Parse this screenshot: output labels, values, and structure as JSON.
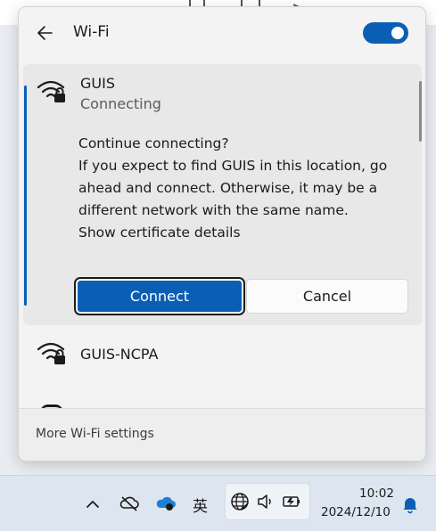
{
  "header": {
    "title": "Wi-Fi",
    "wifi_enabled": true
  },
  "expanded_network": {
    "name": "GUIS",
    "status": "Connecting",
    "prompt_lines": [
      "Continue connecting?",
      "If you expect to find GUIS in this location, go",
      "ahead and connect. Otherwise, it may be a",
      "different network with the same name.",
      "Show certificate details"
    ],
    "connect_label": "Connect",
    "cancel_label": "Cancel"
  },
  "networks": [
    {
      "name": "GUIS-NCPA"
    }
  ],
  "footer": {
    "settings_link": "More Wi-Fi settings"
  },
  "taskbar": {
    "ime_label": "英",
    "time": "10:02",
    "date": "2024/12/10"
  },
  "colors": {
    "accent": "#0a5fb4",
    "panel_bg": "#f3f3f3",
    "card_bg": "#e8e8e8"
  },
  "icons": [
    "back-arrow-icon",
    "wifi-secured-icon",
    "chevron-up-icon",
    "onedrive-offline-icon",
    "onedrive-icon",
    "globe-icon",
    "speaker-icon",
    "battery-charging-icon",
    "bell-icon"
  ]
}
